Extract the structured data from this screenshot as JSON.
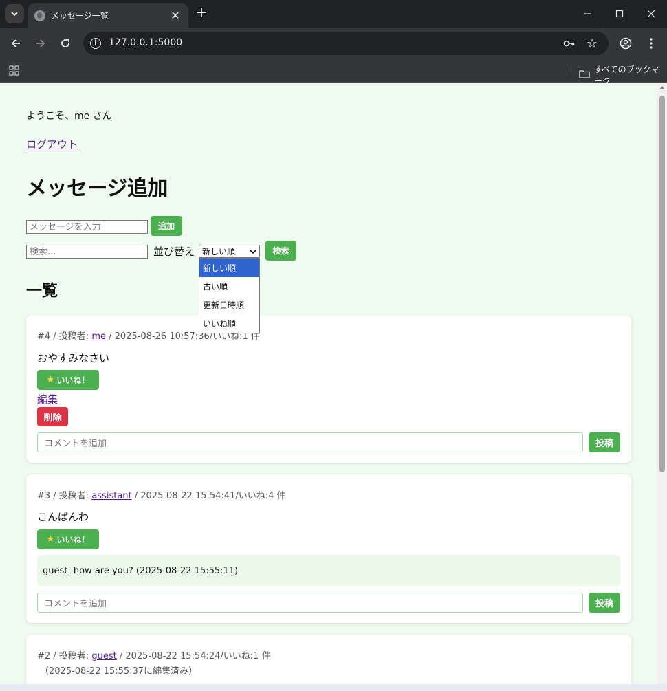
{
  "browser": {
    "tab_title": "メッセージ一覧",
    "url": "127.0.0.1:5000",
    "bookmarks_all": "すべてのブックマーク"
  },
  "page": {
    "welcome": "ようこそ、me さん",
    "logout": "ログアウト",
    "add_heading": "メッセージ追加",
    "message_placeholder": "メッセージを入力",
    "add_button": "追加",
    "search_placeholder": "検索...",
    "sort_label": "並び替え",
    "sort_selected": "新しい順",
    "search_button": "検索",
    "sort_options": [
      "新しい順",
      "古い順",
      "更新日時順",
      "いいね順"
    ],
    "list_heading": "一覧",
    "like_button": "いいね！",
    "edit_link": "編集",
    "delete_button": "削除",
    "comment_placeholder": "コメントを追加",
    "post_button": "投稿"
  },
  "messages": [
    {
      "meta_prefix": "#4 / 投稿者: ",
      "author": "me",
      "meta_suffix": " / 2025-08-26 10:57:36/いいね:1 件",
      "text": "おやすみなさい"
    },
    {
      "meta_prefix": "#3 / 投稿者: ",
      "author": "assistant",
      "meta_suffix": " / 2025-08-22 15:54:41/いいね:4 件",
      "text": "こんばんわ",
      "comment": "guest: how are you? (2025-08-22 15:55:11)"
    },
    {
      "meta_prefix": "#2 / 投稿者: ",
      "author": "guest",
      "meta_suffix": " / 2025-08-22 15:54:24/いいね:1 件",
      "edited_note": "（2025-08-22 15:55:37に編集済み）"
    }
  ]
}
